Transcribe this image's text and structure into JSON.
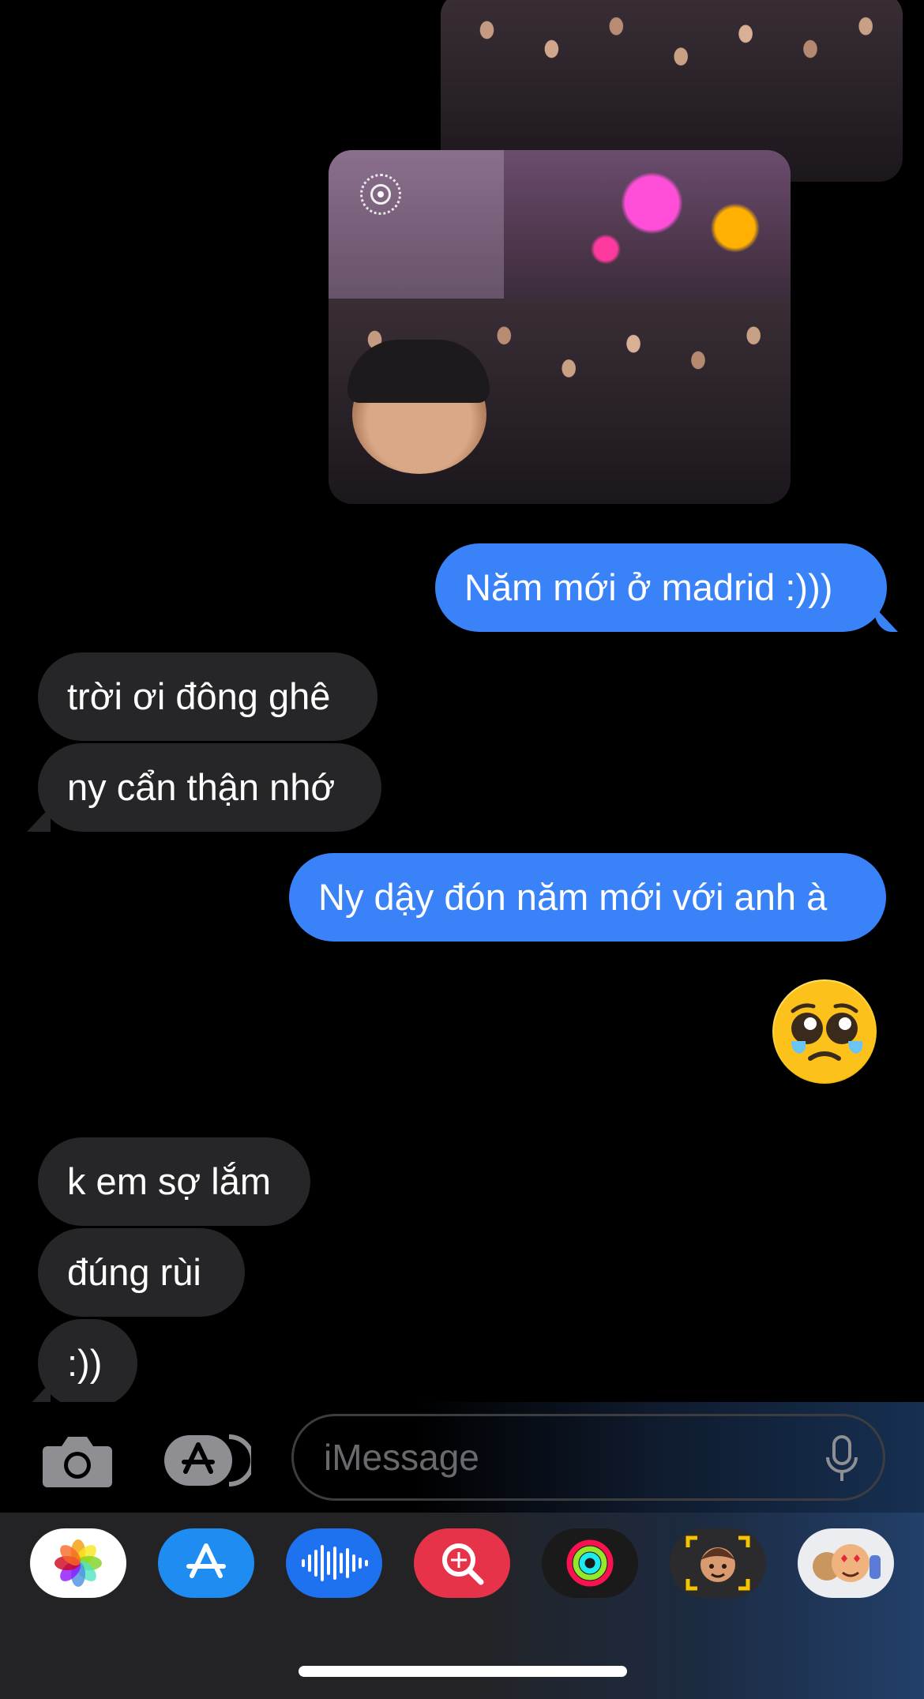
{
  "messages": [
    {
      "side": "out",
      "type": "photo",
      "alt": "crowd-photo-1"
    },
    {
      "side": "out",
      "type": "photo",
      "alt": "crowd-photo-2"
    },
    {
      "side": "out",
      "text": "Năm mới ở madrid :)))"
    },
    {
      "side": "in",
      "text": "trời ơi đông ghê"
    },
    {
      "side": "in",
      "text": "ny cẩn thận nhớ"
    },
    {
      "side": "out",
      "text": "Ny dậy đón năm mới với anh à"
    },
    {
      "side": "out",
      "type": "emoji",
      "emoji": "🥹"
    },
    {
      "side": "in",
      "text": "k em sợ lắm"
    },
    {
      "side": "in",
      "text": "đúng rùi"
    },
    {
      "side": "in",
      "text": ":))"
    }
  ],
  "compose": {
    "placeholder": "iMessage"
  },
  "app_drawer": [
    "photos-icon",
    "app-store-icon",
    "audio-message-icon",
    "images-search-icon",
    "fitness-activity-icon",
    "memoji-icon",
    "memoji-stickers-icon"
  ],
  "colors": {
    "outgoing": "#3a82f7",
    "incoming": "#262628",
    "background": "#000000"
  }
}
